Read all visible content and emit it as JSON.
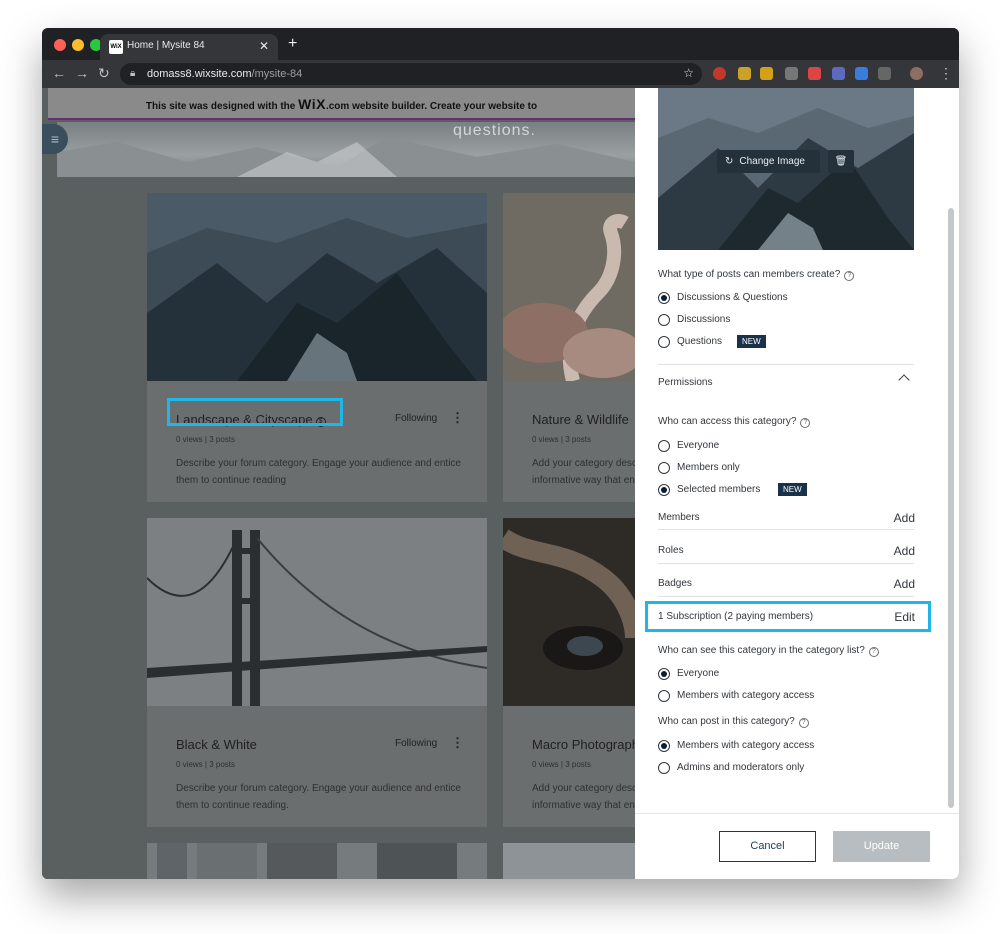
{
  "browser": {
    "tab_title": "Home | Mysite 84",
    "tab_favicon": "WiX",
    "url_host": "domass8.wixsite.com",
    "url_path": "/mysite-84"
  },
  "site": {
    "banner_prefix": "This site was designed with the ",
    "banner_logo": "WiX",
    "banner_suffix": ".com website builder. Create your website to",
    "hero_text": "questions.",
    "cards": [
      {
        "title": "Landscape & Cityscape",
        "following": "Following",
        "meta": "0 views | 3 posts",
        "desc": "Describe your forum category. Engage your audience and entice them to continue reading"
      },
      {
        "title": "Nature & Wildlife",
        "meta": "0 views | 3 posts",
        "desc": "Add your category description in an informative way that engages"
      },
      {
        "title": "Black & White",
        "following": "Following",
        "meta": "0 views | 3 posts",
        "desc": "Describe your forum category. Engage your audience and entice them to continue reading."
      },
      {
        "title": "Macro Photography",
        "meta": "0 views | 3 posts",
        "desc": "Add your category description in an informative way that engages"
      }
    ]
  },
  "panel": {
    "change_image": "Change Image",
    "post_types_question": "What type of posts can members create?",
    "post_types": [
      "Discussions & Questions",
      "Discussions",
      "Questions"
    ],
    "new_badge": "NEW",
    "permissions_title": "Permissions",
    "access_question": "Who can access this category?",
    "access_options": [
      "Everyone",
      "Members only",
      "Selected members"
    ],
    "members_label": "Members",
    "roles_label": "Roles",
    "badges_label": "Badges",
    "add_label": "Add",
    "subscription_label": "1 Subscription (2 paying members)",
    "edit_label": "Edit",
    "see_question": "Who can see this category in the category list?",
    "see_options": [
      "Everyone",
      "Members with category access"
    ],
    "post_question": "Who can post in this category?",
    "post_options": [
      "Members with category access",
      "Admins and moderators only"
    ],
    "cancel": "Cancel",
    "update": "Update"
  },
  "colors": {
    "accent_highlight": "#1fb7e8",
    "badge_bg": "#19324a",
    "primary_dark": "#1b3b59"
  }
}
